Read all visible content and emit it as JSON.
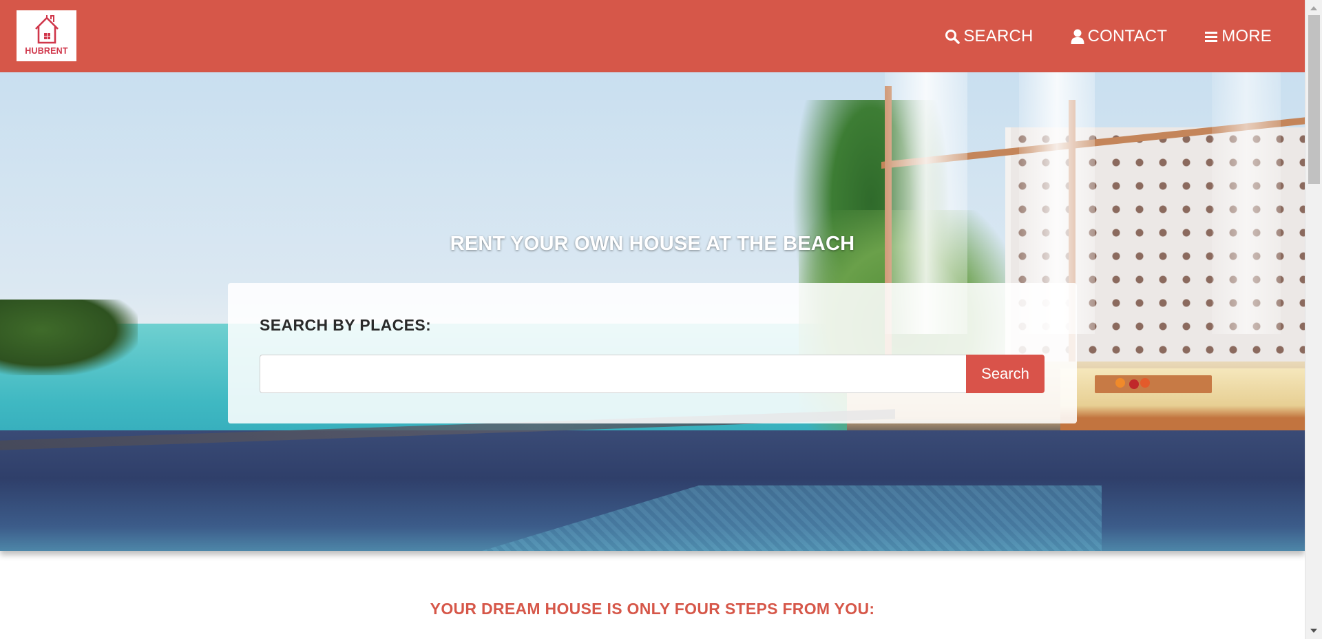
{
  "header": {
    "logo_text": "HUBRENT",
    "brand_color": "#d65749",
    "nav": [
      {
        "label": "SEARCH",
        "icon": "search-icon"
      },
      {
        "label": "CONTACT",
        "icon": "user-icon"
      },
      {
        "label": "MORE",
        "icon": "menu-icon"
      }
    ]
  },
  "hero": {
    "title": "RENT YOUR OWN HOUSE AT THE BEACH",
    "search": {
      "label": "SEARCH BY PLACES:",
      "input_value": "",
      "placeholder": "",
      "button_label": "Search",
      "button_color": "#d9534a"
    }
  },
  "steps": {
    "title": "YOUR DREAM HOUSE IS ONLY FOUR STEPS FROM YOU:"
  }
}
